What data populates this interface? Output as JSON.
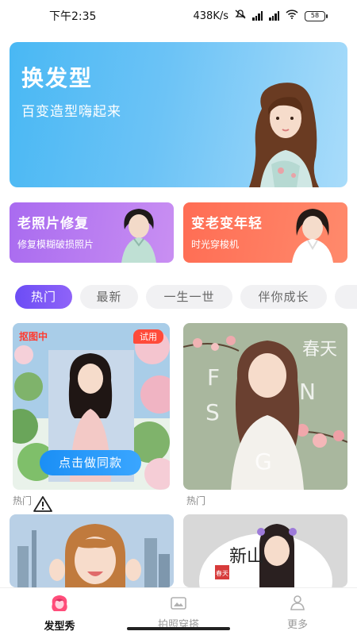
{
  "status_bar": {
    "time": "下午2:35",
    "net_speed": "438K/s",
    "battery": "58"
  },
  "hero": {
    "title": "换发型",
    "subtitle": "百变造型嗨起来"
  },
  "features": [
    {
      "title": "老照片修复",
      "subtitle": "修复模糊破损照片"
    },
    {
      "title": "变老变年轻",
      "subtitle": "时光穿梭机"
    }
  ],
  "chips": [
    {
      "label": "热门",
      "active": true
    },
    {
      "label": "最新"
    },
    {
      "label": "一生一世"
    },
    {
      "label": "伴你成长"
    }
  ],
  "cards": {
    "card1": {
      "badge_left": "抠图中",
      "badge_right": "试用",
      "button": "点击做同款",
      "label": "热门"
    },
    "card2": {
      "label": "热门",
      "art_letters": [
        "F",
        "N",
        "S",
        "G"
      ],
      "art_chars": "春天"
    },
    "card4": {
      "art_chars": "新山",
      "stamp": "春天"
    }
  },
  "report": {
    "label": "举报"
  },
  "bottom_nav": {
    "items": [
      {
        "label": "发型秀",
        "icon": "hair-show-icon",
        "active": true
      },
      {
        "label": "拍照穿搭",
        "icon": "photo-outfit-icon"
      },
      {
        "label": "更多",
        "icon": "user-more-icon"
      }
    ]
  },
  "colors": {
    "accent_purple": "#6c4df5",
    "hero_blue": "#49b8f4",
    "orange": "#ff6d54",
    "button_blue": "#1b8ff5",
    "red_badge": "#ff4b3a"
  }
}
